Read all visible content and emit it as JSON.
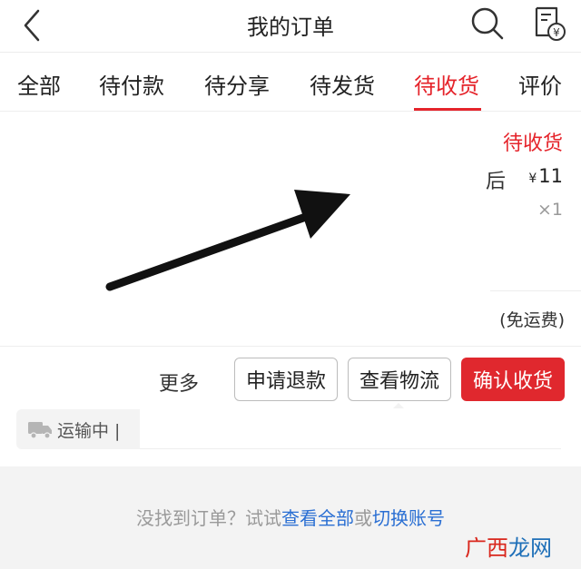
{
  "header": {
    "title": "我的订单",
    "back_icon": "chevron-left-icon",
    "search_icon": "search-icon",
    "bill_icon": "bill-yuan-icon",
    "bill_symbol": "¥"
  },
  "tabs": [
    {
      "label": "全部",
      "active": false
    },
    {
      "label": "待付款",
      "active": false
    },
    {
      "label": "待分享",
      "active": false
    },
    {
      "label": "待发货",
      "active": false
    },
    {
      "label": "待收货",
      "active": true
    },
    {
      "label": "评价",
      "active": false
    }
  ],
  "order": {
    "status": "待收货",
    "name_fragment": "后",
    "price_symbol": "¥",
    "price": "11",
    "quantity": "×1",
    "shipping_note": "(免运费)"
  },
  "actions": {
    "more": "更多",
    "refund": "申请退款",
    "logistics": "查看物流",
    "confirm": "确认收货"
  },
  "tracking": {
    "icon": "truck-icon",
    "text": "运输中 |"
  },
  "footer": {
    "hint_prefix": "没找到订单？试试",
    "link_all": "查看全部",
    "or": "或",
    "link_switch": "切换账号"
  },
  "watermark": {
    "part1": "广西",
    "part2": "龙网"
  },
  "colors": {
    "accent": "#e5242b",
    "link": "#2a6fd3"
  }
}
